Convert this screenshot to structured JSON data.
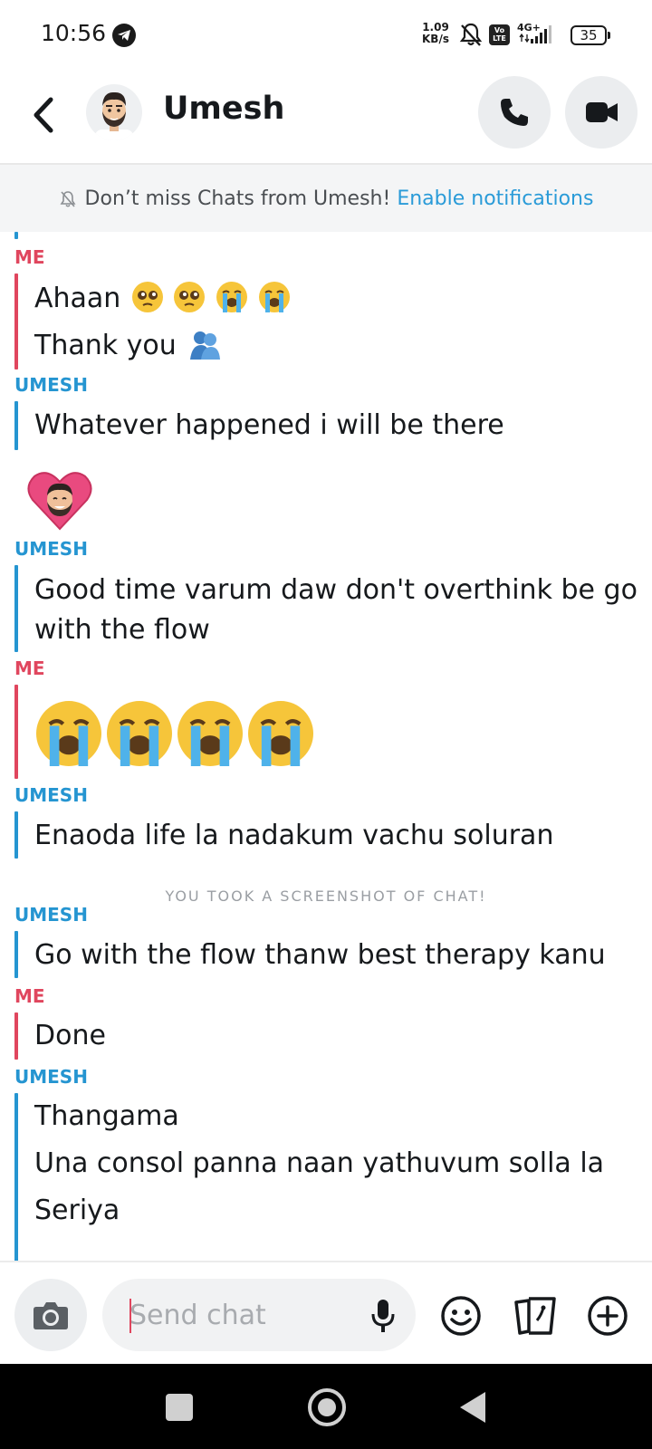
{
  "status_bar": {
    "time": "10:56",
    "speed_value": "1.09",
    "speed_unit": "KB/s",
    "volte_top": "Vo",
    "volte_bottom": "LTE",
    "network": "4G+",
    "battery": "35",
    "icons": [
      "telegram-icon",
      "mute-icon",
      "volte-icon",
      "signal-icon",
      "battery-icon"
    ]
  },
  "header": {
    "contact_name": "Umesh",
    "icons": [
      "back-arrow-icon",
      "avatar",
      "phone-icon",
      "video-camera-icon"
    ]
  },
  "notification_banner": {
    "text": "Don’t miss Chats from Umesh!",
    "link": "Enable notifications"
  },
  "messages": {
    "s1": "ME",
    "m1": "Ahaan",
    "m2": "Thank you",
    "s2": "UMESH",
    "m3": "Whatever happened i will be there",
    "s3": "UMESH",
    "m4_l1": "Good time varum daw don't overthink be go",
    "m4_l2": "with the flow",
    "s4": "ME",
    "s5": "UMESH",
    "m5": "Enaoda life la nadakum vachu soluran",
    "system_note": "YOU TOOK A SCREENSHOT OF CHAT!",
    "s6": "UMESH",
    "m6": "Go with the flow thanw best therapy kanu",
    "s7": "ME",
    "m7": "Done",
    "s8": "UMESH",
    "m8": "Thangama",
    "m9": "Una consol panna naan yathuvum solla la",
    "m10": "Seriya"
  },
  "input_bar": {
    "placeholder": "Send chat",
    "value": ""
  },
  "colors": {
    "me": "#e0465e",
    "umesh": "#2595d1",
    "link": "#2a9bd8",
    "banner_bg": "#f4f5f6"
  }
}
